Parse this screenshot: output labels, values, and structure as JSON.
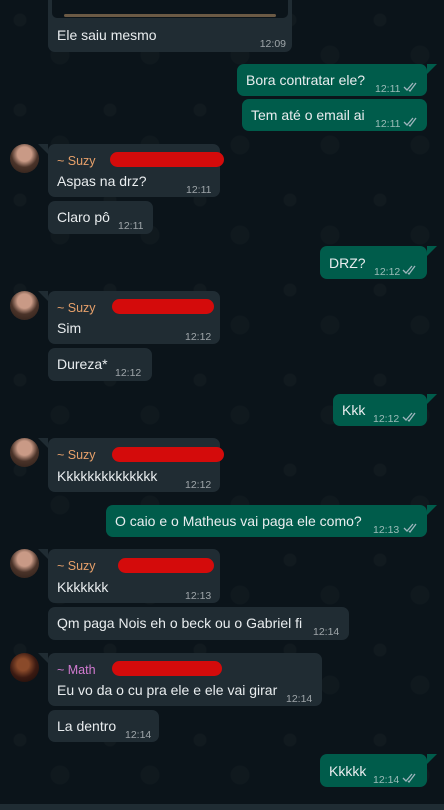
{
  "messages": [
    {
      "text": "Ele saiu mesmo",
      "time": "12:09"
    },
    {
      "text": "Bora contratar ele?",
      "time": "12:11"
    },
    {
      "text": "Tem até o email ai",
      "time": "12:11"
    },
    {
      "sender": "~ Suzy",
      "text": "Aspas na drz?",
      "time": "12:11"
    },
    {
      "text": "Claro pô",
      "time": "12:11"
    },
    {
      "text": "DRZ?",
      "time": "12:12"
    },
    {
      "sender": "~ Suzy",
      "text": "Sim",
      "time": "12:12"
    },
    {
      "text": "Dureza*",
      "time": "12:12"
    },
    {
      "text": "Kkk",
      "time": "12:12"
    },
    {
      "sender": "~ Suzy",
      "text": "Kkkkkkkkkkkkkk",
      "time": "12:12"
    },
    {
      "text": "O caio e o Matheus vai paga ele como?",
      "time": "12:13"
    },
    {
      "sender": "~ Suzy",
      "text": "Kkkkkkk",
      "time": "12:13"
    },
    {
      "text": "Qm paga Nois eh o beck ou o Gabriel fi",
      "time": "12:14"
    },
    {
      "sender": "~ Math",
      "text": "Eu vo da o cu pra ele e ele vai girar",
      "time": "12:14"
    },
    {
      "text": "La dentro",
      "time": "12:14"
    },
    {
      "text": "Kkkkk",
      "time": "12:14"
    }
  ],
  "colors": {
    "background": "#0b141a",
    "incoming": "#202c33",
    "outgoing": "#005c4b",
    "sender_suzy": "#e6a06a",
    "sender_math": "#d17ad0",
    "read_ticks": "#53bdeb"
  }
}
